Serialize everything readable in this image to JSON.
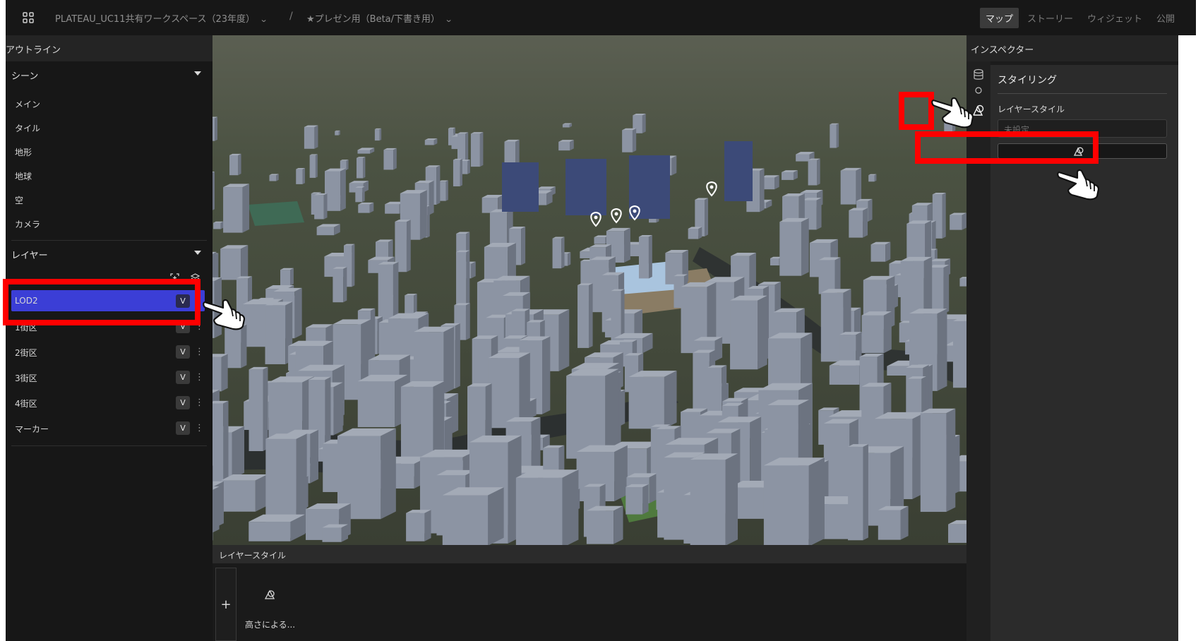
{
  "topbar": {
    "workspace": "PLATEAU_UC11共有ワークスペース（23年度）",
    "separator": "/",
    "project": "★プレゼン用（Beta/下書き用）",
    "tabs": [
      "マップ",
      "ストーリー",
      "ウィジェット",
      "公開"
    ],
    "active_tab": "マップ"
  },
  "outline": {
    "title": "アウトライン",
    "scene_header": "シーン",
    "scene_items": [
      "メイン",
      "タイル",
      "地形",
      "地球",
      "空",
      "カメラ"
    ],
    "layers_header": "レイヤー",
    "layers": [
      {
        "name": "LOD2",
        "badge": "V",
        "selected": true
      },
      {
        "name": "1街区",
        "badge": "V",
        "selected": false
      },
      {
        "name": "2街区",
        "badge": "V",
        "selected": false
      },
      {
        "name": "3街区",
        "badge": "V",
        "selected": false
      },
      {
        "name": "4街区",
        "badge": "V",
        "selected": false
      },
      {
        "name": "マーカー",
        "badge": "V",
        "selected": false
      }
    ],
    "more_glyph": "⋮"
  },
  "layer_style_panel": {
    "title": "レイヤースタイル",
    "add_label": "+",
    "preset_label": "高さによる..."
  },
  "inspector": {
    "title": "インスペクター",
    "section_title": "スタイリング",
    "layer_style_label": "レイヤースタイル",
    "select_placeholder": "未設定"
  },
  "icons": {
    "dashboard": "grid-icon",
    "style": "style-shapes-icon",
    "database": "database-icon",
    "marker": "map-pin-icon"
  },
  "colors": {
    "highlight": "#ff0000",
    "selected_layer": "#3b3ed6",
    "building": "#8c94a3"
  }
}
